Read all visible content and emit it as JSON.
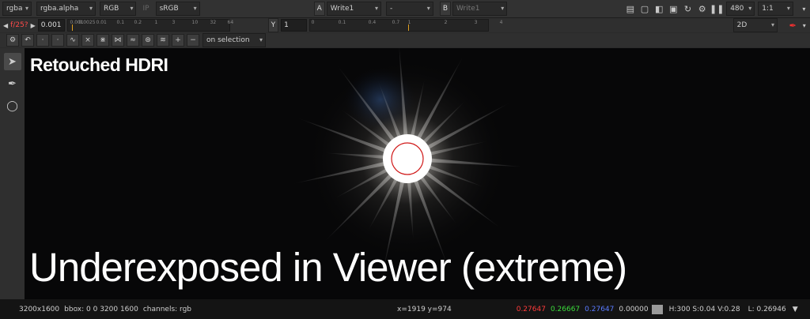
{
  "toolbar": {
    "channels": "rgba",
    "alpha": "rgba.alpha",
    "colorspace": "RGB",
    "ip": "IP",
    "lut": "sRGB",
    "input_a_tag": "A",
    "input_a": "Write1",
    "wipe": "-",
    "input_b_tag": "B",
    "input_b": "Write1",
    "proxy": "480",
    "zoom": "1:1"
  },
  "controls": {
    "fstop": "f/25?",
    "gain": "0.001",
    "gamma_tag": "Y",
    "gamma": "1",
    "gain_ticks": [
      "0.001",
      "0.0025",
      "0.01",
      "0.1",
      "0.2",
      "1",
      "3",
      "10",
      "32",
      "64"
    ],
    "gamma_ticks": [
      "0",
      "0.1",
      "0.4",
      "0.7",
      "1",
      "2",
      "3",
      "4"
    ],
    "view_mode": "2D"
  },
  "tools": {
    "selection_mode": "on selection"
  },
  "viewer": {
    "title": "Retouched HDRI",
    "caption": "Underexposed in Viewer (extreme)"
  },
  "status": {
    "format": "3200x1600",
    "bbox": "bbox: 0 0 3200 1600",
    "channels": "channels: rgb",
    "coords": "x=1919 y=974",
    "r": "0.27647",
    "g": "0.26667",
    "b": "0.27647",
    "a": "0.00000",
    "hsv": "H:300 S:0.04 V:0.28",
    "luminance": "L: 0.26946"
  },
  "colors": {
    "red": "#ff3b3b",
    "green": "#3bdc3b",
    "blue": "#4a6bff",
    "accent": "#e0a020"
  }
}
